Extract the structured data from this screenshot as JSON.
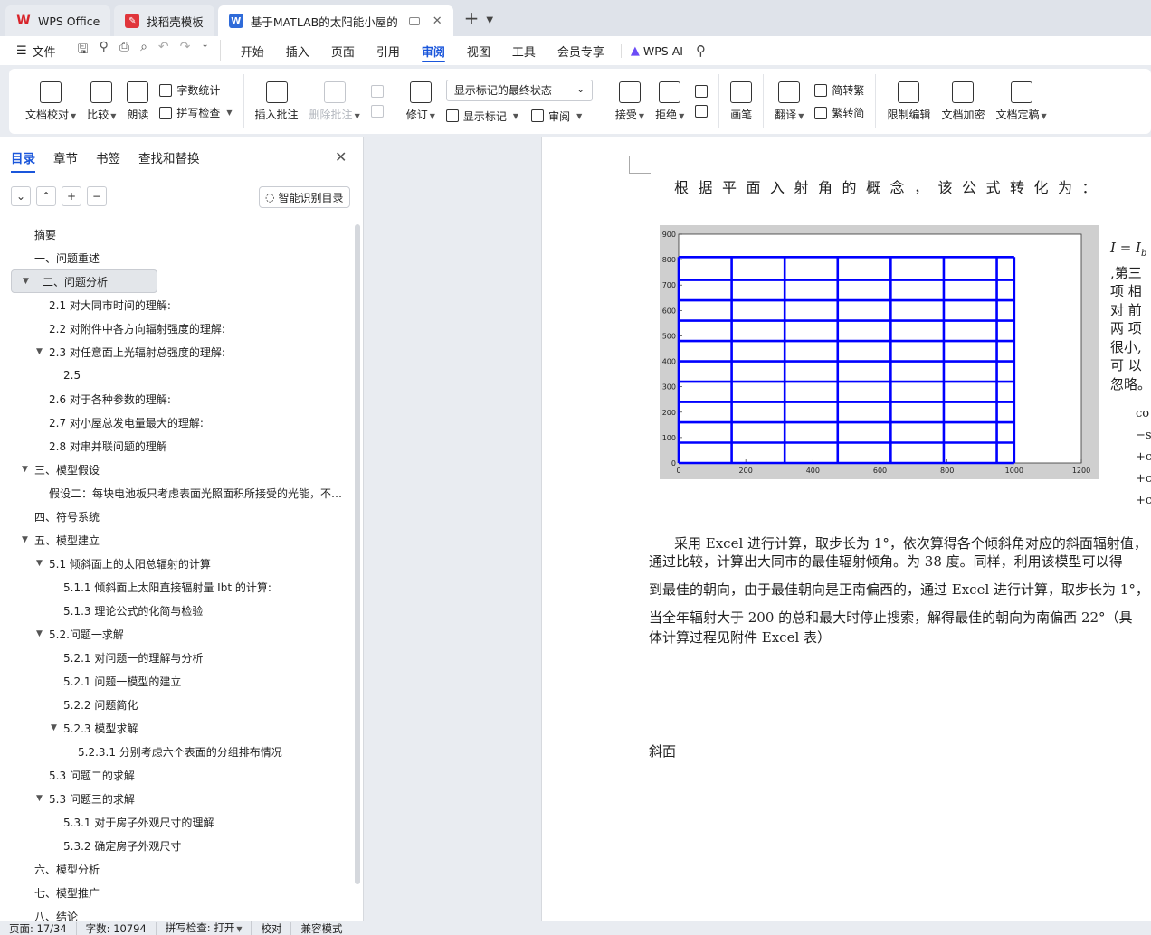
{
  "tabs": [
    {
      "label": "WPS Office",
      "icon": "wps-logo-icon",
      "active": false
    },
    {
      "label": "找稻壳模板",
      "icon": "docer-icon",
      "active": false
    },
    {
      "label": "基于MATLAB的太阳能小屋的",
      "icon": "word-doc-icon",
      "active": true
    }
  ],
  "menu": {
    "file": "文件",
    "items": [
      "开始",
      "插入",
      "页面",
      "引用",
      "审阅",
      "视图",
      "工具",
      "会员专享"
    ],
    "active": "审阅",
    "wps_ai": "WPS AI"
  },
  "ribbon": {
    "doc_check": "文档校对",
    "compare": "比较",
    "read_aloud": "朗读",
    "word_count": "字数统计",
    "spell_check": "拼写检查",
    "insert_comment": "插入批注",
    "delete_comment": "删除批注",
    "revise": "修订",
    "markup_state": "显示标记的最终状态",
    "show_markup": "显示标记",
    "review": "审阅",
    "accept": "接受",
    "reject": "拒绝",
    "pen": "画笔",
    "translate": "翻译",
    "to_traditional": "简转繁",
    "to_simplified": "繁转简",
    "restrict_edit": "限制编辑",
    "doc_encrypt": "文档加密",
    "doc_finalize": "文档定稿"
  },
  "nav": {
    "tabs": [
      "目录",
      "章节",
      "书签",
      "查找和替换"
    ],
    "smart_toc": "智能识别目录",
    "toc": [
      {
        "label": "摘要",
        "level": 1,
        "arrow": false
      },
      {
        "label": "一、问题重述",
        "level": 1,
        "arrow": false
      },
      {
        "label": "二、问题分析",
        "level": 1,
        "arrow": true,
        "selected": true
      },
      {
        "label": "2.1 对大同市时间的理解:",
        "level": 2,
        "arrow": false
      },
      {
        "label": "2.2 对附件中各方向辐射强度的理解:",
        "level": 2,
        "arrow": false
      },
      {
        "label": "2.3 对任意面上光辐射总强度的理解:",
        "level": 2,
        "arrow": true
      },
      {
        "label": "2.5",
        "level": 3,
        "arrow": false
      },
      {
        "label": "2.6 对于各种参数的理解:",
        "level": 2,
        "arrow": false
      },
      {
        "label": "2.7 对小屋总发电量最大的理解:",
        "level": 2,
        "arrow": false
      },
      {
        "label": "2.8 对串并联问题的理解",
        "level": 2,
        "arrow": false
      },
      {
        "label": "三、模型假设",
        "level": 1,
        "arrow": true
      },
      {
        "label": "假设二：每块电池板只考虑表面光照面积所接受的光能，不…",
        "level": 2,
        "arrow": false
      },
      {
        "label": "四、符号系统",
        "level": 1,
        "arrow": false
      },
      {
        "label": "五、模型建立",
        "level": 1,
        "arrow": true
      },
      {
        "label": "5.1 倾斜面上的太阳总辐射的计算",
        "level": 2,
        "arrow": true
      },
      {
        "label": "5.1.1 倾斜面上太阳直接辐射量 Ibt 的计算:",
        "level": 3,
        "arrow": false
      },
      {
        "label": "5.1.3 理论公式的化简与检验",
        "level": 3,
        "arrow": false
      },
      {
        "label": "5.2.问题一求解",
        "level": 2,
        "arrow": true
      },
      {
        "label": "5.2.1 对问题一的理解与分析",
        "level": 3,
        "arrow": false
      },
      {
        "label": "5.2.1 问题一模型的建立",
        "level": 3,
        "arrow": false
      },
      {
        "label": "5.2.2 问题简化",
        "level": 3,
        "arrow": false
      },
      {
        "label": "5.2.3 模型求解",
        "level": 3,
        "arrow": true
      },
      {
        "label": "5.2.3.1 分别考虑六个表面的分组排布情况",
        "level": 4,
        "arrow": false
      },
      {
        "label": "5.3 问题二的求解",
        "level": 2,
        "arrow": false
      },
      {
        "label": "5.3 问题三的求解",
        "level": 2,
        "arrow": true
      },
      {
        "label": "5.3.1 对于房子外观尺寸的理解",
        "level": 3,
        "arrow": false
      },
      {
        "label": "5.3.2 确定房子外观尺寸",
        "level": 3,
        "arrow": false
      },
      {
        "label": "六、模型分析",
        "level": 1,
        "arrow": false
      },
      {
        "label": "七、模型推广",
        "level": 1,
        "arrow": false
      },
      {
        "label": "八、结论",
        "level": 1,
        "arrow": false
      }
    ]
  },
  "doc": {
    "heading_line": "根据平面入射角的概念，该公式转化为：",
    "side_formula_top": "I = I",
    "side_text": [
      ",第三",
      "项 相",
      "对 前",
      "两 项",
      "很小,",
      "可 以",
      "忽略。"
    ],
    "formulas": [
      "co",
      "−s",
      "+c",
      "+c",
      "+c"
    ],
    "paragraphs": [
      "采用 Excel 进行计算，取步长为 1°，依次算得各个倾斜角对应的斜面辐射值，",
      "通过比较，计算出大同市的最佳辐射倾角。为 38 度。同样，利用该模型可以得",
      "到最佳的朝向，由于最佳朝向是正南偏西的，通过 Excel 进行计算，取步长为 1°，",
      "当全年辐射大于 200 的总和最大时停止搜索，解得最佳的朝向为南偏西 22°（具",
      "体计算过程见附件 Excel 表）"
    ],
    "label_bottom": "斜面"
  },
  "chart_data": {
    "type": "line",
    "title": "",
    "xlabel": "",
    "ylabel": "",
    "xlim": [
      0,
      1200
    ],
    "ylim": [
      0,
      900
    ],
    "xticks": [
      0,
      200,
      400,
      600,
      800,
      1000,
      1200
    ],
    "yticks": [
      0,
      100,
      200,
      300,
      400,
      500,
      600,
      700,
      800,
      900
    ],
    "grid": false,
    "line_color": "#0000ff",
    "vertical_lines_x": [
      0,
      158,
      316,
      474,
      632,
      790,
      948,
      1000
    ],
    "horizontal_lines_y": [
      0,
      80,
      160,
      240,
      320,
      400,
      480,
      560,
      640,
      720,
      810
    ],
    "outline": {
      "x_max": 1000,
      "y_max": 810
    }
  },
  "status": {
    "page": "页面: 17/34",
    "words": "字数: 10794",
    "spell": "拼写检查: 打开",
    "proof": "校对",
    "compat": "兼容模式"
  }
}
